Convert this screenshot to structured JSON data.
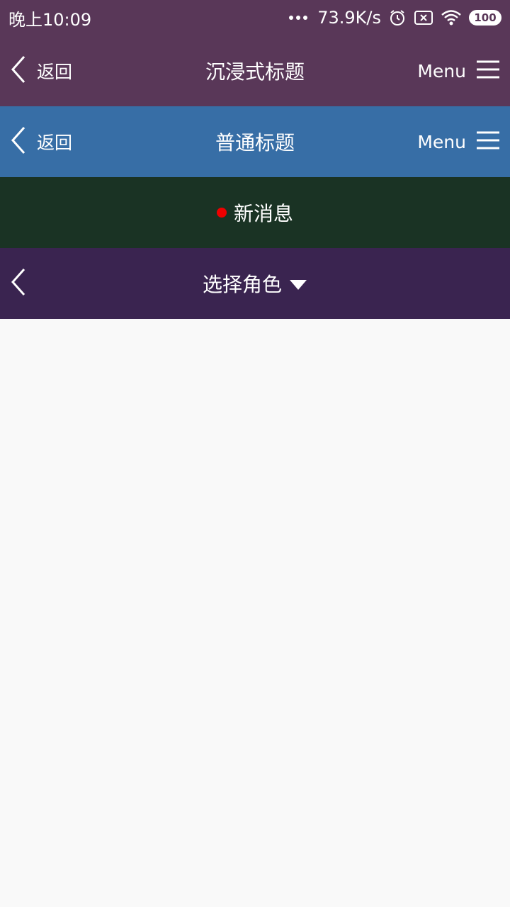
{
  "status_bar": {
    "time": "晚上10:09",
    "network_speed": "73.9K/s",
    "battery_level": "100",
    "icons": [
      "more-dots-icon",
      "alarm-icon",
      "sim-x-icon",
      "wifi-icon",
      "battery-icon"
    ]
  },
  "immersive_bar": {
    "back_label": "返回",
    "title": "沉浸式标题",
    "menu_label": "Menu",
    "background": "#593758"
  },
  "normal_bar": {
    "back_label": "返回",
    "title": "普通标题",
    "menu_label": "Menu",
    "background": "#376ea6"
  },
  "message_bar": {
    "label": "新消息",
    "dot_color": "#ee0000",
    "background": "#1a3324"
  },
  "role_bar": {
    "title": "选择角色",
    "background": "#3a2450"
  }
}
